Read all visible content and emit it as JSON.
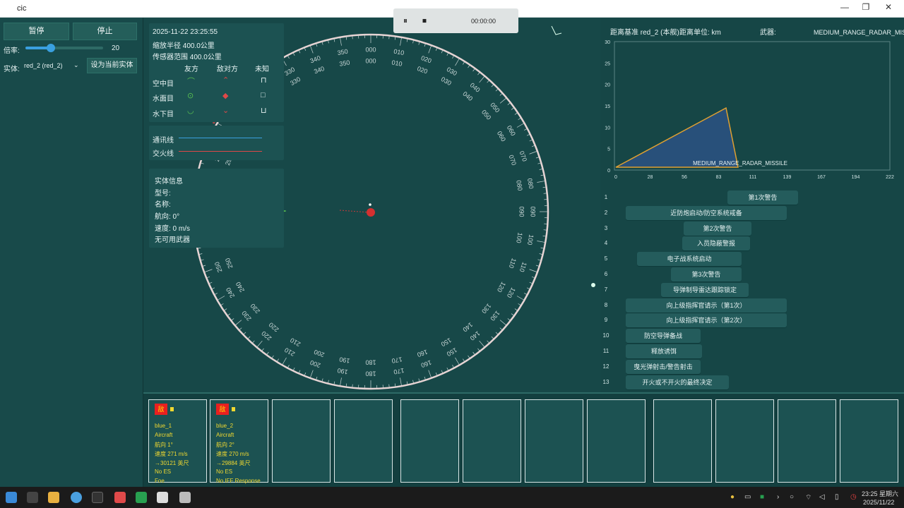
{
  "window": {
    "title": "cic",
    "minimize": "—",
    "maximize": "❐",
    "close": "✕"
  },
  "media": {
    "pause": "⏸",
    "stop": "⏹",
    "time": "00:00:00"
  },
  "controls": {
    "pause_label": "暂停",
    "stop_label": "停止",
    "rate_label": "倍率:",
    "rate_value": "20",
    "rate_fraction": 0.33,
    "entity_label": "实体:",
    "entity_value": "red_2 (red_2)",
    "set_current_label": "设为当前实体"
  },
  "radar": {
    "timestamp": "2025-11-22 23:25:55",
    "zoom_radius": "缩放半径 400.0公里",
    "sensor_range": "传感器范围 400.0公里",
    "legend_headers": [
      "友方",
      "敌对方",
      "未知"
    ],
    "legend_rows": [
      "空中目",
      "水面目",
      "水下目"
    ],
    "lines": [
      {
        "label": "通讯线",
        "color": "#3aa0e0"
      },
      {
        "label": "交火线",
        "color": "#e04848"
      }
    ],
    "entity_info": {
      "title": "实体信息",
      "model": "型号:",
      "name": "名称:",
      "heading": "航向: 0°",
      "speed": "速度: 0 m/s",
      "weapons": "无可用武器"
    },
    "compass_labels": [
      "000",
      "010",
      "020",
      "030",
      "040",
      "050",
      "060",
      "070",
      "080",
      "090",
      "100",
      "110",
      "120",
      "130",
      "140",
      "150",
      "160",
      "170",
      "180",
      "190",
      "200",
      "210",
      "220",
      "230",
      "240",
      "250",
      "260",
      "270",
      "280",
      "290",
      "300",
      "310",
      "320",
      "330",
      "340",
      "350"
    ]
  },
  "right": {
    "ref_label": "距离基准 red_2 (本舰)",
    "unit_label": "距离单位: km",
    "weapon_label": "武器:",
    "weapon_value": "MEDIUM_RANGE_RADAR_MISSILE",
    "chart": {
      "label": "MEDIUM_RANGE_RADAR_MISSILE",
      "y_ticks": [
        "30",
        "25",
        "20",
        "15",
        "10",
        "5",
        "0"
      ],
      "x_ticks": [
        "0",
        "28",
        "56",
        "83",
        "111",
        "139",
        "167",
        "194",
        "222"
      ]
    },
    "events": [
      {
        "n": "1",
        "label": "第1次警告"
      },
      {
        "n": "2",
        "label": "近防炮启动/防空系统戒备"
      },
      {
        "n": "3",
        "label": "第2次警告"
      },
      {
        "n": "4",
        "label": "入员隐蔽警报"
      },
      {
        "n": "5",
        "label": "电子战系统启动"
      },
      {
        "n": "6",
        "label": "第3次警告"
      },
      {
        "n": "7",
        "label": "导弹制导雷达跟踪锁定"
      },
      {
        "n": "8",
        "label": "向上级指挥官请示（第1次）"
      },
      {
        "n": "9",
        "label": "向上级指挥官请示（第2次）"
      },
      {
        "n": "10",
        "label": "防空导弹备战"
      },
      {
        "n": "11",
        "label": "释放诱饵"
      },
      {
        "n": "12",
        "label": "曳光弹射击/警告射击"
      },
      {
        "n": "13",
        "label": "开火或不开火的最终决定"
      }
    ]
  },
  "cards": [
    {
      "flag": "敌",
      "name": "blue_1",
      "type": "Aircraft",
      "heading": "航向 1°",
      "speed": "速度 271 m/s",
      "alt": "→30121 英尺",
      "es": "No ES",
      "iff": "Foe"
    },
    {
      "flag": "敌",
      "name": "blue_2",
      "type": "Aircraft",
      "heading": "航向 2°",
      "speed": "速度 270 m/s",
      "alt": "→29884 英尺",
      "es": "No ES",
      "iff": "No IFF Response"
    }
  ],
  "taskbar": {
    "time": "23:25 星期六",
    "date": "2025/11/22"
  }
}
